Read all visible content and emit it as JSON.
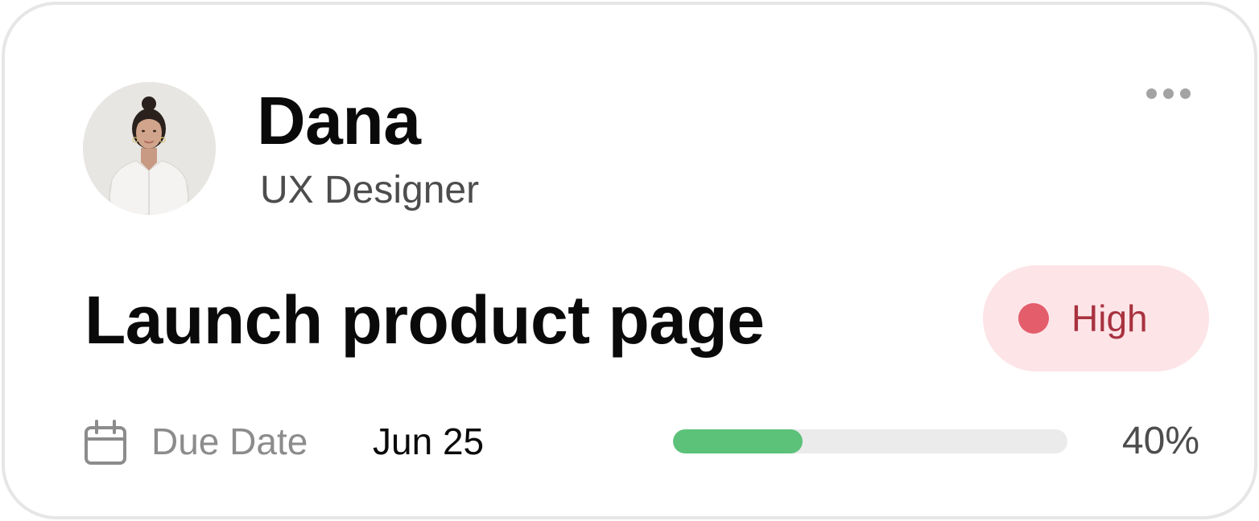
{
  "assignee": {
    "name": "Dana",
    "role": "UX Designer",
    "avatar": "person-photo"
  },
  "menu": {
    "icon": "more-horizontal-icon"
  },
  "task": {
    "title": "Launch product page"
  },
  "priority": {
    "label": "High",
    "dot_color": "#e35d6a",
    "text_color": "#a8323f",
    "background_color": "#fde4e7"
  },
  "due": {
    "icon": "calendar-icon",
    "label": "Due Date",
    "value": "Jun 25"
  },
  "progress": {
    "percent": 40,
    "label": "40%",
    "fill_color": "#5cc27a",
    "track_color": "#ebebeb"
  }
}
